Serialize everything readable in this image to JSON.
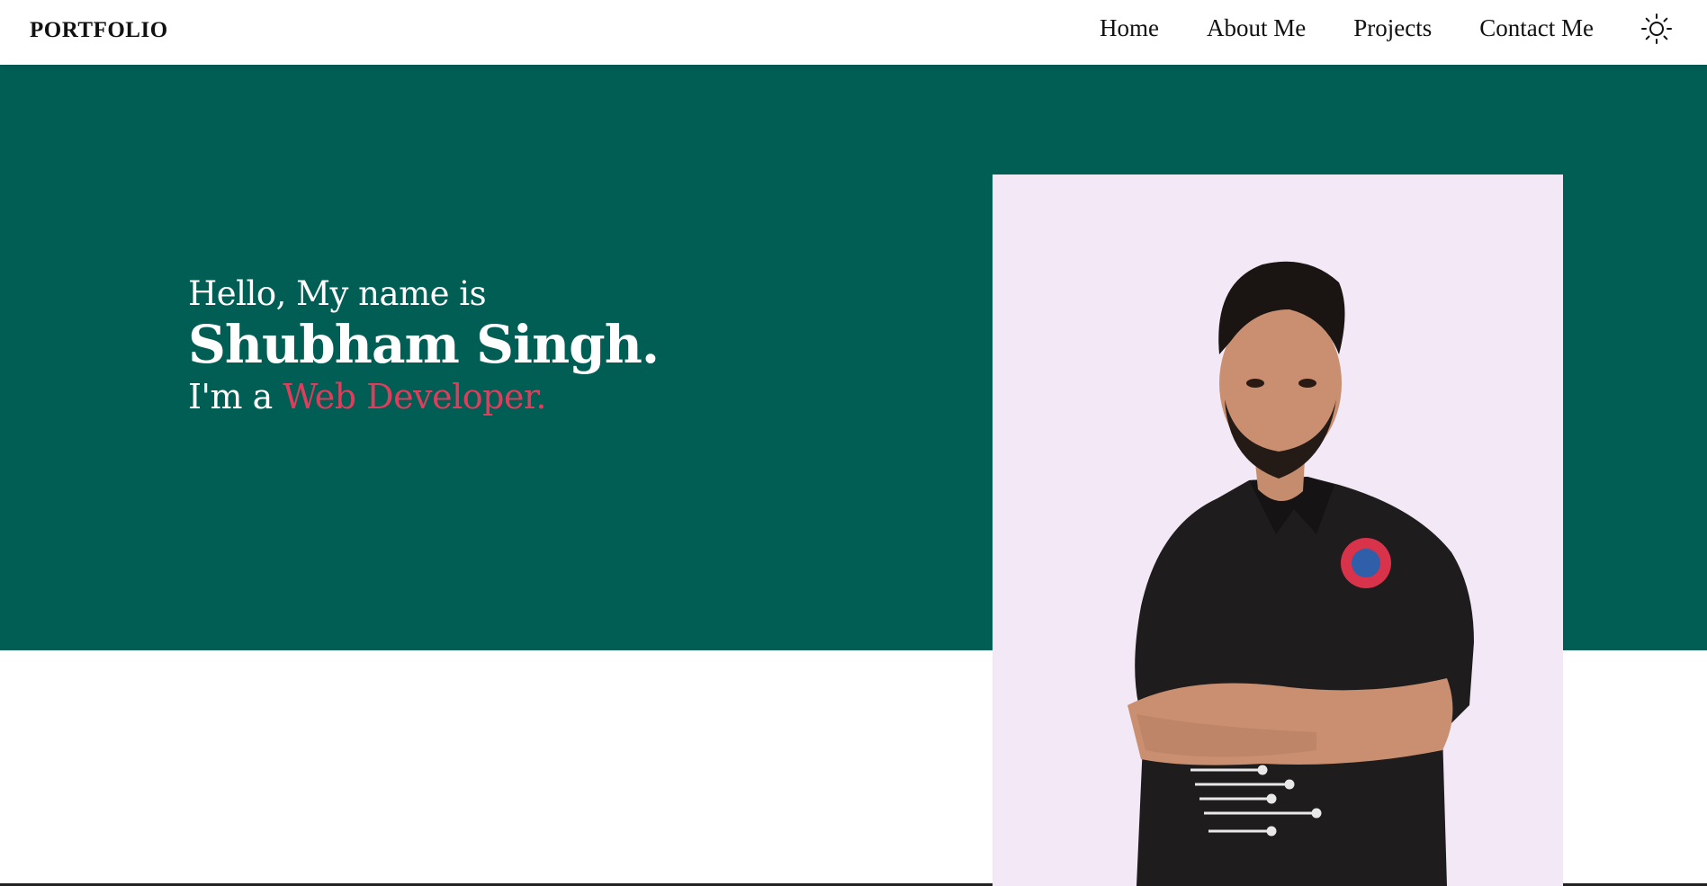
{
  "nav": {
    "brand": "PORTFOLIO",
    "links": [
      {
        "label": "Home"
      },
      {
        "label": "About Me"
      },
      {
        "label": "Projects"
      },
      {
        "label": "Contact Me"
      }
    ],
    "theme_icon": "sun-icon"
  },
  "hero": {
    "greeting": "Hello, My name is",
    "name": "Shubham Singh.",
    "role_prefix": "I'm a",
    "role": "Web Developer.",
    "background_color": "#005e54",
    "accent_color": "#e23c5c"
  },
  "portrait": {
    "subject": "person-with-crossed-arms",
    "background_color": "#f2e8f6"
  }
}
